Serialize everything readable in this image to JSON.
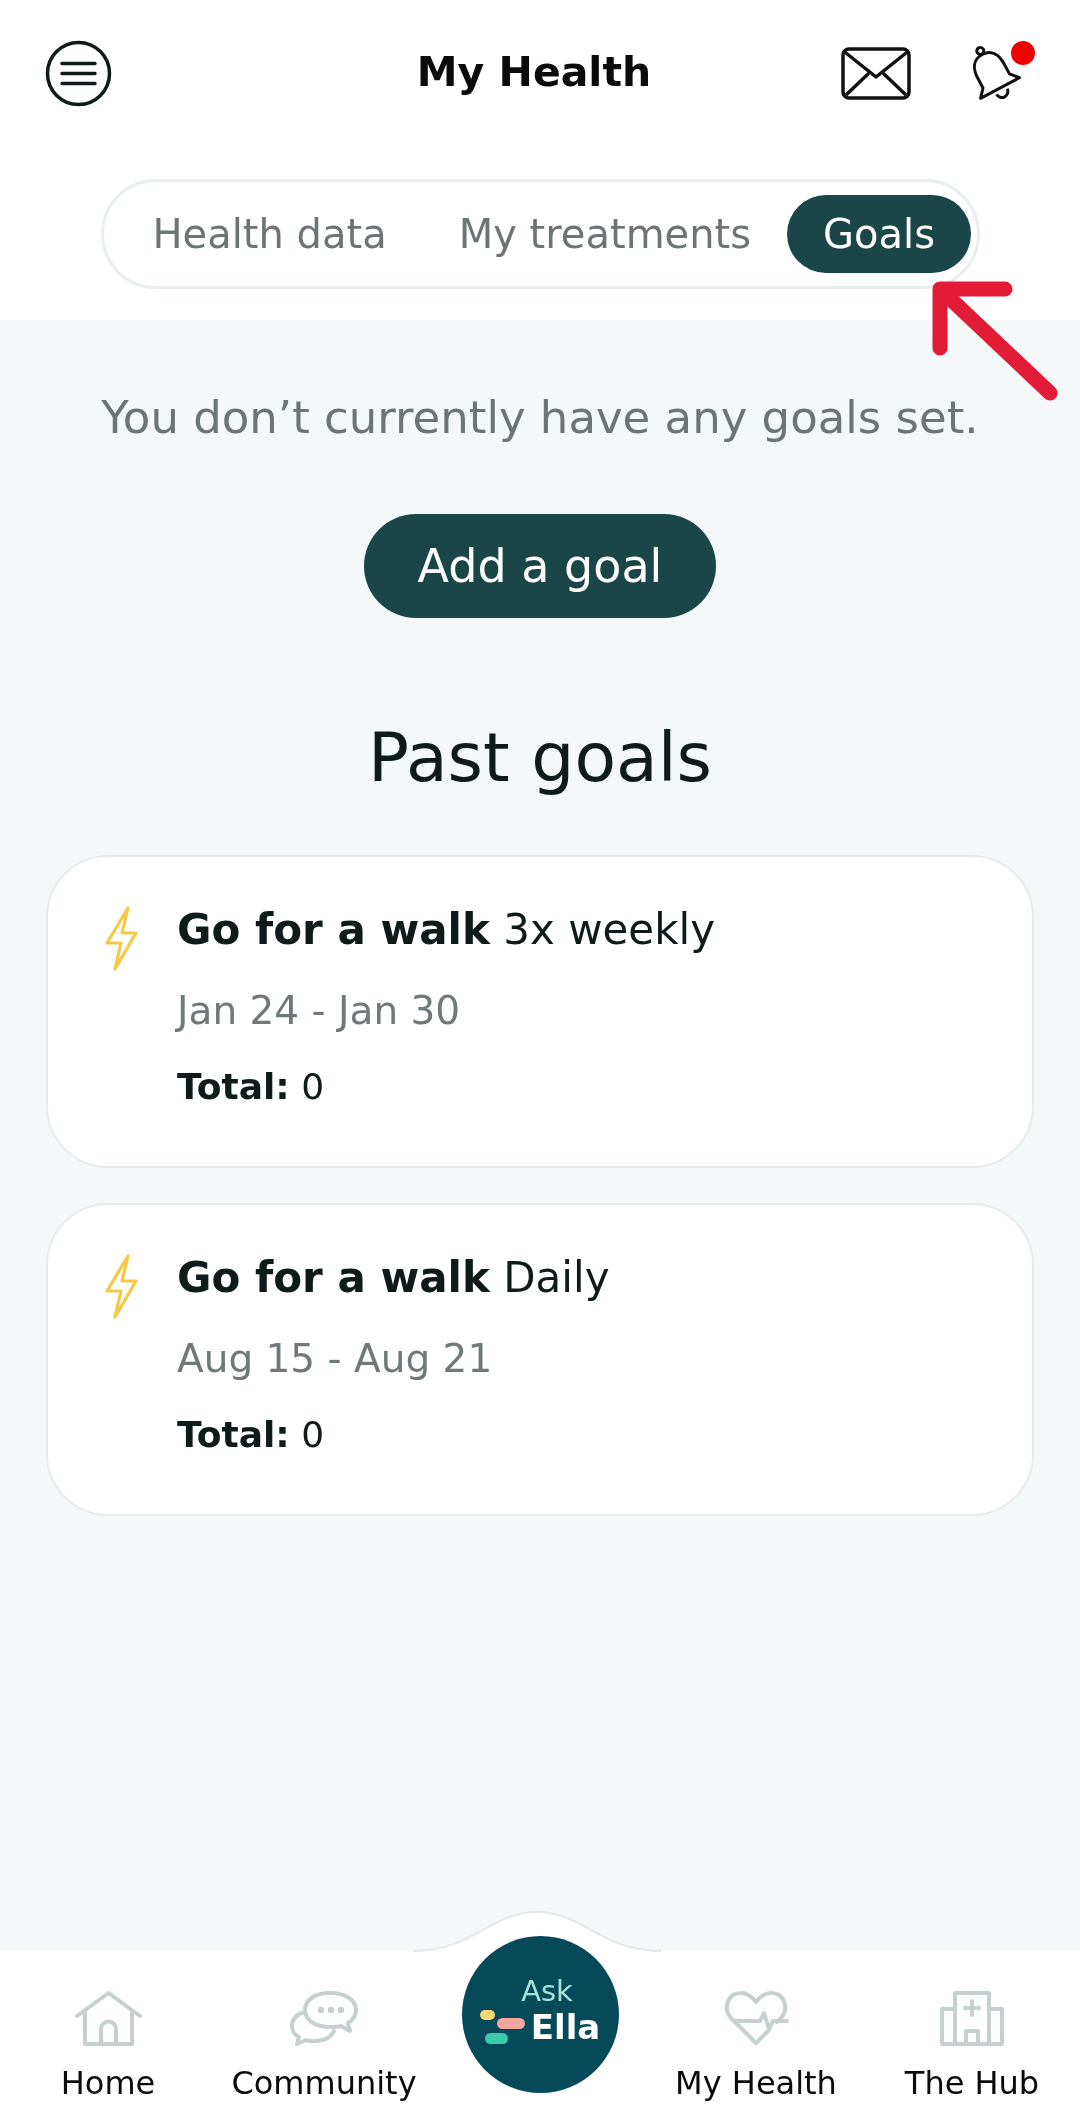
{
  "header": {
    "title": "My Health",
    "notifications_unread": true
  },
  "tabs": [
    {
      "label": "Health data",
      "selected": false
    },
    {
      "label": "My treatments",
      "selected": false
    },
    {
      "label": "Goals",
      "selected": true
    }
  ],
  "goals": {
    "empty_message": "You don’t currently have any goals set.",
    "add_button": "Add a goal",
    "past_heading": "Past goals",
    "past_goals": [
      {
        "title": "**Go for a walk** 3x weekly",
        "dates": "Jan 24 - Jan 30",
        "total": "**Total:** 0"
      },
      {
        "title": "**Go for a walk** Daily",
        "dates": "Aug 15 - Aug 21",
        "total": "**Total:** 0"
      }
    ]
  },
  "bottom_nav": [
    {
      "kind": "tab",
      "label": "Home"
    },
    {
      "kind": "tab",
      "label": "Community"
    },
    {
      "kind": "assistant",
      "label_small": "Ask",
      "label": "Ella"
    },
    {
      "kind": "tab",
      "label": "My Health"
    },
    {
      "kind": "tab",
      "label": "The Hub"
    }
  ]
}
